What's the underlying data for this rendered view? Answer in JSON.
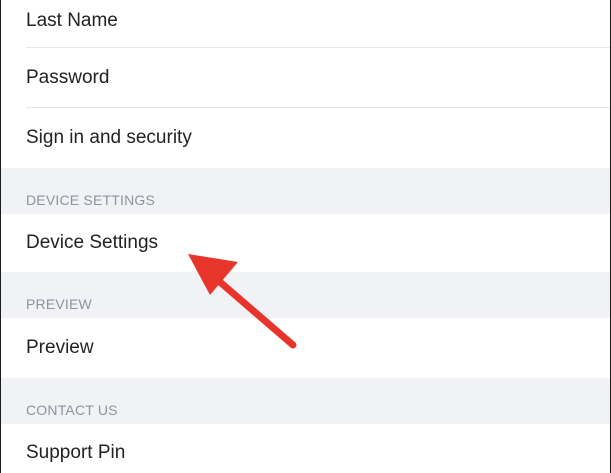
{
  "settings": {
    "rows": {
      "last_name": "Last Name",
      "password": "Password",
      "sign_in_security": "Sign in and security",
      "device_settings": "Device Settings",
      "preview": "Preview",
      "support_pin": "Support Pin"
    },
    "sections": {
      "device_settings": "DEVICE SETTINGS",
      "preview": "PREVIEW",
      "contact_us": "CONTACT US"
    }
  },
  "annotation": {
    "arrow_color": "#e8352b",
    "arrow_target": "Device Settings"
  }
}
